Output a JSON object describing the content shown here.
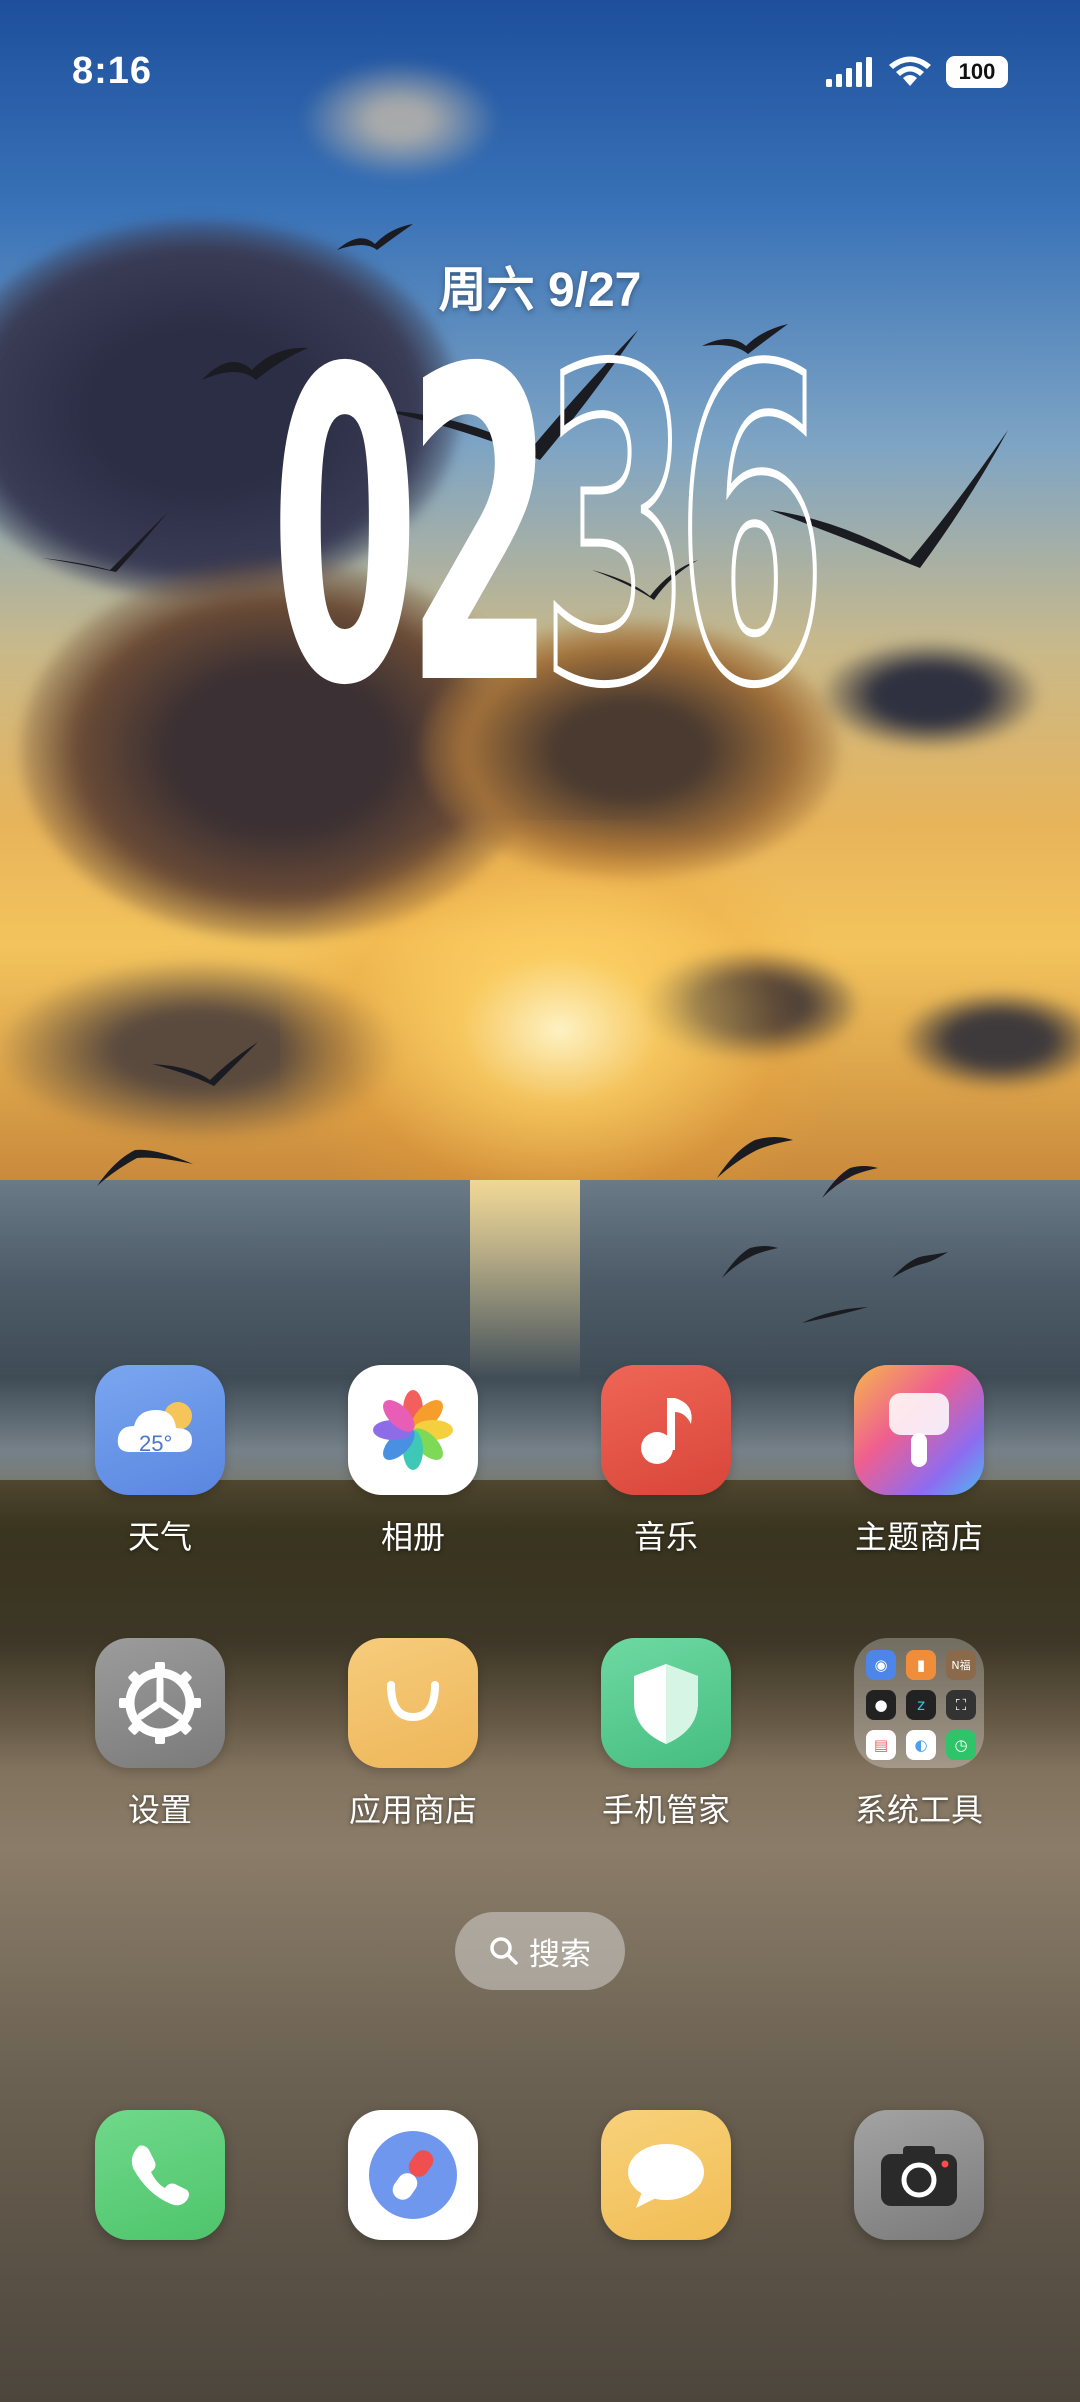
{
  "status_bar": {
    "time": "8:16",
    "battery": "100",
    "icons": [
      "signal-icon",
      "wifi-icon",
      "battery-icon"
    ]
  },
  "clock_widget": {
    "date": "周六 9/27",
    "hours": "02",
    "minutes": "36"
  },
  "apps": [
    {
      "label": "天气",
      "icon": "weather-icon",
      "badge_text": "25°",
      "color": "#6f9ae8"
    },
    {
      "label": "相册",
      "icon": "gallery-icon",
      "color": "#ffffff"
    },
    {
      "label": "音乐",
      "icon": "music-icon",
      "color": "#e5564a"
    },
    {
      "label": "主题商店",
      "icon": "themes-icon",
      "color": "#e86ab0"
    },
    {
      "label": "设置",
      "icon": "settings-icon",
      "color": "#8e8e8e"
    },
    {
      "label": "应用商店",
      "icon": "app-store-icon",
      "color": "#f2c26b"
    },
    {
      "label": "手机管家",
      "icon": "security-icon",
      "color": "#5ccf94"
    },
    {
      "label": "系统工具",
      "icon": "system-tools-folder",
      "folder_text": "N福",
      "color": "#ffffff"
    }
  ],
  "search": {
    "label": "搜索",
    "icon": "search-icon"
  },
  "dock": [
    {
      "name": "phone",
      "icon": "phone-icon",
      "color": "#5fcf7b"
    },
    {
      "name": "browser",
      "icon": "browser-icon",
      "color": "#ffffff"
    },
    {
      "name": "messages",
      "icon": "messages-icon",
      "color": "#f4c462"
    },
    {
      "name": "camera",
      "icon": "camera-icon",
      "color": "#8c8c8c"
    }
  ]
}
